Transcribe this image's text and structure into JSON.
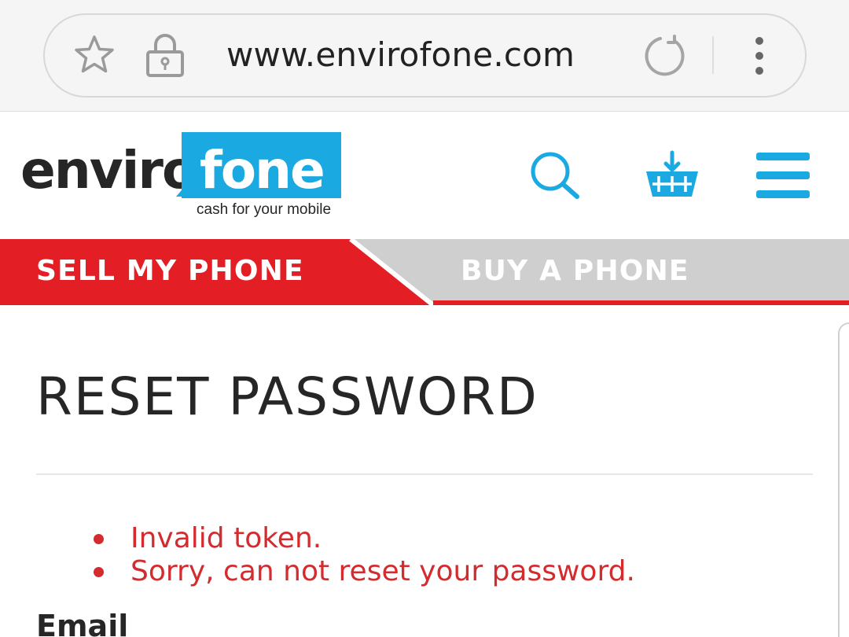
{
  "browser": {
    "url": "www.envirofone.com",
    "icons": [
      "star-icon",
      "lock-icon",
      "reload-icon",
      "more-vert-icon"
    ]
  },
  "site": {
    "logo_part1": "enviro",
    "logo_part2": "fone",
    "tagline": "cash for your mobile",
    "header_icons": [
      "search-icon",
      "basket-icon",
      "hamburger-menu-icon"
    ],
    "colors": {
      "brand_blue": "#1ba9e1",
      "brand_red": "#e31e24",
      "tab_grey": "#cfcfcf",
      "text_dark": "#262626",
      "error_red": "#d42b2f"
    }
  },
  "tabs": {
    "sell": "SELL MY PHONE",
    "buy": "BUY A PHONE",
    "active": "sell"
  },
  "main": {
    "title": "RESET PASSWORD",
    "errors": [
      "Invalid token.",
      "Sorry, can not reset your password."
    ],
    "email_label": "Email"
  }
}
